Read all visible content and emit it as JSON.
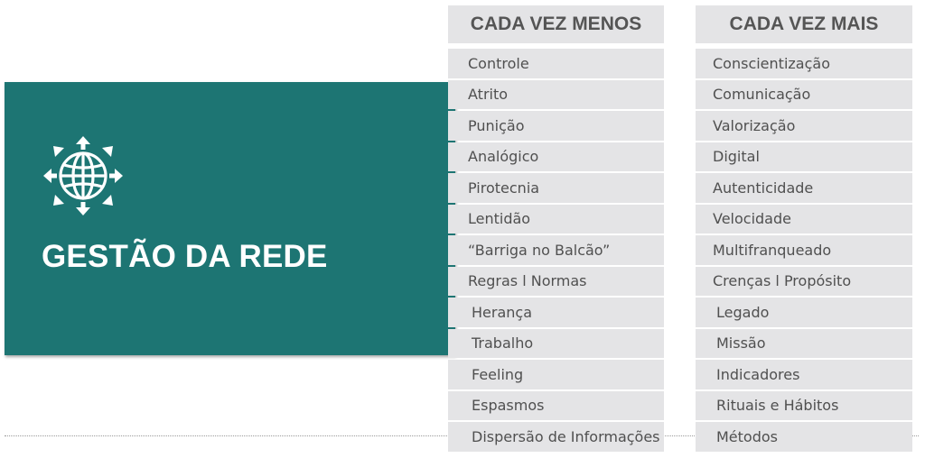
{
  "card": {
    "title": "GESTÃO DA REDE",
    "icon": "globe-network-icon",
    "color": "#1d7573"
  },
  "columns": {
    "left": {
      "header": "CADA VEZ MENOS",
      "items": [
        "Controle",
        "Atrito",
        "Punição",
        "Analógico",
        "Pirotecnia",
        "Lentidão",
        "“Barriga no Balcão”",
        "Regras l Normas",
        "Herança",
        "Trabalho",
        "Feeling",
        "Espasmos",
        "Dispersão de Informações"
      ]
    },
    "right": {
      "header": "CADA VEZ MAIS",
      "items": [
        "Conscientização",
        "Comunicação",
        "Valorização",
        "Digital",
        "Autenticidade",
        "Velocidade",
        "Multifranqueado",
        "Crenças l Propósito",
        "Legado",
        "Missão",
        "Indicadores",
        "Rituais e Hábitos",
        "Métodos"
      ]
    }
  }
}
